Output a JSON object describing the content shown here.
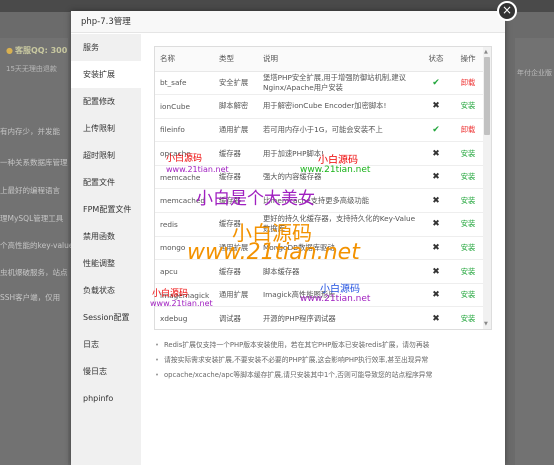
{
  "background": {
    "qq": "客服QQ: 300",
    "notice": "15天无理由退款",
    "right_text": "年付企业版",
    "lines": [
      "有内存少，并发能",
      "一种关系数据库管理",
      "上最好的编程语言",
      "理MySQL管理工具",
      "个高性能的key-value",
      "虫机爆破服务，站点",
      "SSH客户端，仅用"
    ]
  },
  "modal": {
    "title": "php-7.3管理",
    "close": "×",
    "menu": [
      "服务",
      "安装扩展",
      "配置修改",
      "上传限制",
      "超时限制",
      "配置文件",
      "FPM配置文件",
      "禁用函数",
      "性能调整",
      "负载状态",
      "Session配置",
      "日志",
      "慢日志",
      "phpinfo"
    ],
    "columns": {
      "name": "名称",
      "type": "类型",
      "desc": "说明",
      "status": "状态",
      "op": "操作"
    },
    "rows": [
      {
        "name": "bt_safe",
        "type": "安全扩展",
        "desc": "堡塔PHP安全扩展,用于增强防御站机制,建议Nginx/Apache用户安装",
        "status": "ok",
        "op": "卸载"
      },
      {
        "name": "ionCube",
        "type": "脚本解密",
        "desc": "用于解密ionCube Encoder加密脚本!",
        "status": "no",
        "op": "安装"
      },
      {
        "name": "fileinfo",
        "type": "通用扩展",
        "desc": "若可用内存小于1G，可能会安装不上",
        "status": "ok",
        "op": "卸载"
      },
      {
        "name": "opcache",
        "type": "缓存器",
        "desc": "用于加速PHP脚本!",
        "status": "no",
        "op": "安装"
      },
      {
        "name": "memcache",
        "type": "缓存器",
        "desc": "强大的内容缓存器",
        "status": "no",
        "op": "安装"
      },
      {
        "name": "memcached",
        "type": "缓存器",
        "desc": "比memcache支持更多高级功能",
        "status": "no",
        "op": "安装"
      },
      {
        "name": "redis",
        "type": "缓存器",
        "desc": "更好的持久化缓存器，支持持久化的Key-Value数据库",
        "status": "no",
        "op": "安装"
      },
      {
        "name": "mongo",
        "type": "通用扩展",
        "desc": "MongoDB数据库驱动",
        "status": "no",
        "op": "安装"
      },
      {
        "name": "apcu",
        "type": "缓存器",
        "desc": "脚本缓存器",
        "status": "no",
        "op": "安装"
      },
      {
        "name": "imagemagick",
        "type": "通用扩展",
        "desc": "Imagick高性能图形库",
        "status": "no",
        "op": "安装"
      },
      {
        "name": "xdebug",
        "type": "调试器",
        "desc": "开源的PHP程序调试器",
        "status": "no",
        "op": "安装"
      }
    ],
    "notes": [
      "Redis扩展仅支持一个PHP版本安装使用，若在其它PHP版本已安装redis扩展，请勿再装",
      "请按实际需求安装扩展,不要安装不必要的PHP扩展,这会影响PHP执行效率,甚至出现异常",
      "opcache/xcache/apc等脚本缓存扩展,请只安装其中1个,否则可能导致您的站点程序异常"
    ]
  },
  "watermarks": {
    "small1": "小白源码",
    "url1": "www.21tian.net",
    "small2": "小白源码",
    "url2": "www.21tian.net",
    "big": "小白是个大美女",
    "big2": "小白源码",
    "bigurl": "www.21tian.net",
    "small3": "小白源码",
    "url3": "www.21tian.net",
    "small4": "小白源码",
    "url4": "www.21tian.net"
  },
  "colors": {
    "install": "#20a53a",
    "uninstall": "#e33333",
    "check": "#20a53a"
  }
}
